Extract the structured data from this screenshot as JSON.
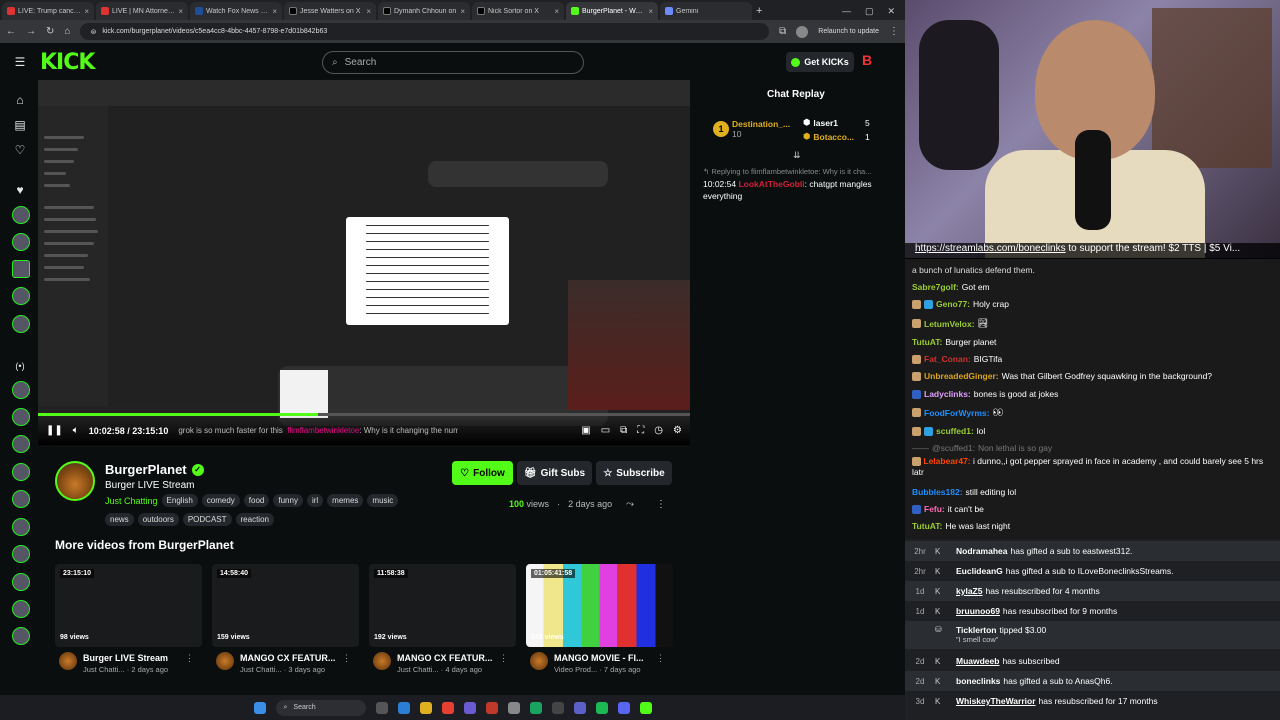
{
  "browser": {
    "tabs": [
      {
        "title": "LIVE: Trump cancels strike",
        "active": false
      },
      {
        "title": "LIVE | MN Attorney Gene",
        "active": false
      },
      {
        "title": "Watch Fox News Chan",
        "active": false
      },
      {
        "title": "Jesse Watters on X",
        "active": false
      },
      {
        "title": "Dymanh Chhoun on",
        "active": false
      },
      {
        "title": "Nick Sortor on X",
        "active": false
      },
      {
        "title": "BurgerPlanet - Watch",
        "active": true
      },
      {
        "title": "Gemini",
        "active": false
      }
    ],
    "url": "kick.com/burgerplanet/videos/c5ea4cc8-4bbc-4457-8798-e7d01b842b63",
    "relaunch_label": "Relaunch to update"
  },
  "kick": {
    "logo": "KICK",
    "search_placeholder": "Search",
    "get_kicks_label": "Get KICKs",
    "video": {
      "time_current": "10:02:58",
      "time_total": "23:15:10",
      "time_display": "10:02:58 / 23:15:10",
      "progress_fraction": 0.43,
      "ticker_text": "grok is so much faster for this",
      "ticker_user": "flimflambetwinkletoe",
      "ticker_text2": ": Why is it changing the numb"
    },
    "channel": {
      "name": "BurgerPlanet",
      "stream_title": "Burger LIVE Stream",
      "category": "Just Chatting",
      "tags_row1": [
        "English",
        "comedy",
        "food",
        "funny",
        "irl",
        "memes",
        "music"
      ],
      "tags_row2": [
        "news",
        "outdoors",
        "PODCAST",
        "reaction"
      ],
      "views_count": "100",
      "views_label": "views",
      "posted": "2 days ago"
    },
    "buttons": {
      "follow": "Follow",
      "gift_subs": "Gift Subs",
      "subscribe": "Subscribe"
    },
    "more_videos_title": "More videos from BurgerPlanet",
    "videos": [
      {
        "duration": "23:15:10",
        "views": "98 views",
        "title": "Burger LIVE Stream",
        "meta": "Just Chatti... · 2 days ago"
      },
      {
        "duration": "14:58:40",
        "views": "159 views",
        "title": "MANGO CX FEATUR...",
        "meta": "Just Chatti... · 3 days ago"
      },
      {
        "duration": "11:58:38",
        "views": "192 views",
        "title": "MANGO CX FEATUR...",
        "meta": "Just Chatti... · 4 days ago"
      },
      {
        "duration": "01:05:41:58",
        "views": "243 views",
        "title": "MANGO MOVIE - FI...",
        "meta": "Video Prod... · 7 days ago"
      }
    ],
    "chat_replay": {
      "title": "Chat Replay",
      "gifters": [
        {
          "rank": "1",
          "name": "Destination_...",
          "count": "10"
        },
        {
          "rank": "",
          "name": "laser1",
          "count": "5"
        },
        {
          "rank": "",
          "name": "Botacco...",
          "count": "1"
        }
      ],
      "reply_text": "Replying to flimflambetwinkletoe: Why is it cha...",
      "msg_time": "10:02:54",
      "msg_user": "LookAtTheGobli",
      "msg_text": "chatgpt mangles everything"
    }
  },
  "stream_overlay": {
    "link_text": "https://streamlabs.com/boneclinks",
    "link_suffix": "to support the stream! $2 TTS | $5 Vi...",
    "chat": [
      {
        "user": "",
        "text": "a bunch of lunatics defend them.",
        "color": "#ffffff"
      },
      {
        "user": "Sabre7golf:",
        "text": "Got em",
        "color": "#9acd32"
      },
      {
        "user": "Geno77:",
        "text": "Holy crap",
        "color": "#9acd32"
      },
      {
        "user": "LetumVelox:",
        "text": "",
        "color": "#9acd32"
      },
      {
        "user": "TutuAT:",
        "text": "Burger planet",
        "color": "#9acd32"
      },
      {
        "user": "Fat_Conan:",
        "text": "BIGTifa",
        "color": "#d03030"
      },
      {
        "user": "UnbreadedGinger:",
        "text": "Was that Gilbert Godfrey squawking in the background?",
        "color": "#daa520"
      },
      {
        "user": "Ladyclinks:",
        "text": "bones is good at jokes",
        "color": "#e0a0ff"
      },
      {
        "user": "FoodForWyrms:",
        "text": "",
        "color": "#1e90ff"
      },
      {
        "user": "scuffed1:",
        "text": "lol",
        "color": "#9acd32"
      },
      {
        "user": "@scuffed1:",
        "text": "Non lethal is so gay",
        "color": "#777777"
      },
      {
        "user": "Lelabear47:",
        "text": "i dunno,,i got pepper sprayed in face in academy , and could barely see 5 hrs latr",
        "color": "#ff4500"
      },
      {
        "user": "Bubbles182:",
        "text": "still editing lol",
        "color": "#1e90ff"
      },
      {
        "user": "Fefu:",
        "text": "it can't be",
        "color": "#ff69b4"
      },
      {
        "user": "TutuAT:",
        "text": "He was last night",
        "color": "#9acd32"
      }
    ],
    "events": [
      {
        "time": "2hr",
        "user": "Nodramahea",
        "text": "has gifted a sub to eastwest312."
      },
      {
        "time": "2hr",
        "user": "EuclideanG",
        "text": "has gifted a sub to ILoveBoneclinksStreams."
      },
      {
        "time": "1d",
        "user": "kylaZ5",
        "text": "has resubscribed for 4 months"
      },
      {
        "time": "1d",
        "user": "bruunoo69",
        "text": "has resubscribed for 9 months"
      },
      {
        "time": "",
        "user": "Ticklerton",
        "text": "tipped $3.00",
        "sub": "\"I smell cow\""
      },
      {
        "time": "2d",
        "user": "Muawdeeb",
        "text": "has subscribed"
      },
      {
        "time": "2d",
        "user": "boneclinks",
        "text": "has gifted a sub to AnasQh6."
      },
      {
        "time": "3d",
        "user": "WhiskeyTheWarrior",
        "text": "has resubscribed for 17 months"
      }
    ]
  },
  "taskbar": {
    "search_placeholder": "Search"
  },
  "colors": {
    "kick_green": "#53fc18",
    "bg": "#0b0e0f",
    "panel": "#24272c"
  }
}
